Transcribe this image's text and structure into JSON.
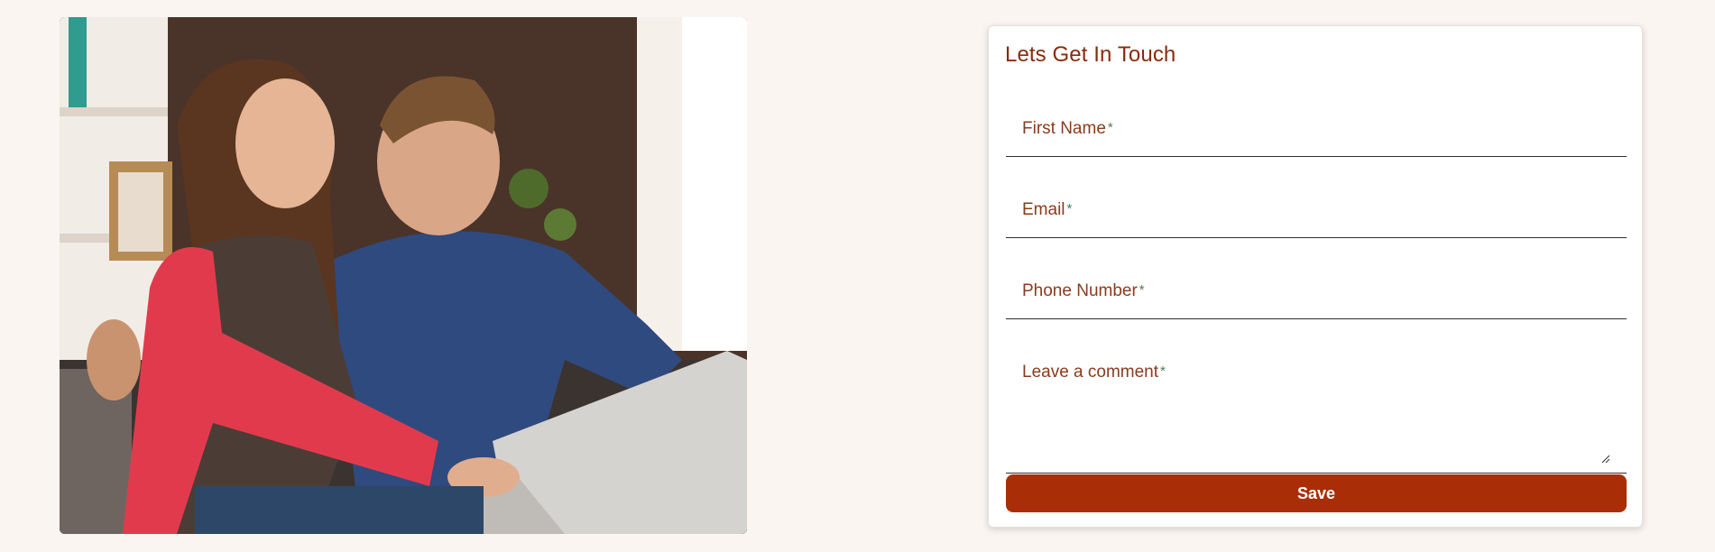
{
  "photo": {
    "subject": "couple-using-laptop"
  },
  "contact": {
    "title": "Lets Get In Touch",
    "required_mark": "*",
    "fields": [
      {
        "label": "First Name",
        "value": ""
      },
      {
        "label": "Email",
        "value": ""
      },
      {
        "label": "Phone Number",
        "value": ""
      },
      {
        "label": "Leave a comment",
        "value": ""
      }
    ],
    "save_label": "Save"
  },
  "colors": {
    "page_bg": "#fbf5f2",
    "accent": "#a92e08",
    "title": "#8a2a0c",
    "label": "#8a3b1e",
    "required": "#4e7b5a"
  }
}
